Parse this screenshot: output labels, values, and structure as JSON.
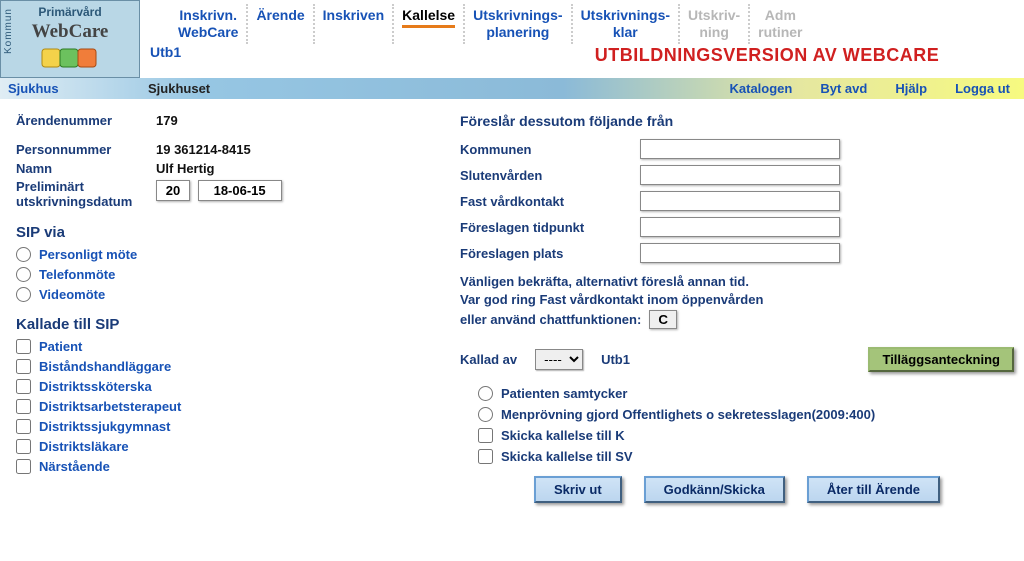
{
  "logo": {
    "top": "Primärvård",
    "name": "WebCare",
    "side": "Kommun"
  },
  "tabs": [
    {
      "l1": "Inskrivn.",
      "l2": "WebCare",
      "active": false,
      "disabled": false
    },
    {
      "l1": "Ärende",
      "l2": "",
      "active": false,
      "disabled": false
    },
    {
      "l1": "Inskriven",
      "l2": "",
      "active": false,
      "disabled": false
    },
    {
      "l1": "Kallelse",
      "l2": "",
      "active": true,
      "disabled": false
    },
    {
      "l1": "Utskrivnings-",
      "l2": "planering",
      "active": false,
      "disabled": false
    },
    {
      "l1": "Utskrivnings-",
      "l2": "klar",
      "active": false,
      "disabled": false
    },
    {
      "l1": "Utskriv-",
      "l2": "ning",
      "active": false,
      "disabled": true
    },
    {
      "l1": "Adm",
      "l2": "rutiner",
      "active": false,
      "disabled": true
    }
  ],
  "banner_left": "Utb1",
  "banner": "UTBILDNINGSVERSION AV WEBCARE",
  "subbar": {
    "col1_label": "Sjukhus",
    "col1_val": "Sjukhuset",
    "links": [
      "Katalogen",
      "Byt avd",
      "Hjälp",
      "Logga ut"
    ]
  },
  "left": {
    "arendenummer_label": "Ärendenummer",
    "arendenummer": "179",
    "personnummer_label": "Personnummer",
    "personnummer": "19 361214-8415",
    "namn_label": "Namn",
    "namn": "Ulf Hertig",
    "prelim_label1": "Preliminärt",
    "prelim_label2": "utskrivningsdatum",
    "date_y": "20",
    "date_rest": "18-06-15",
    "sip_heading": "SIP via",
    "sip_options": [
      "Personligt möte",
      "Telefonmöte",
      "Videomöte"
    ],
    "kallade_heading": "Kallade till SIP",
    "kallade_options": [
      "Patient",
      "Biståndshandläggare",
      "Distriktssköterska",
      "Distriktsarbetsterapeut",
      "Distriktssjukgymnast",
      "Distriktsläkare",
      "Närstående"
    ]
  },
  "right": {
    "heading": "Föreslår dessutom följande från",
    "fields": [
      {
        "label": "Kommunen",
        "name": "kommunen"
      },
      {
        "label": "Slutenvården",
        "name": "slutenvarden"
      },
      {
        "label": "Fast vårdkontakt",
        "name": "fast-vardkontakt"
      },
      {
        "label": "Föreslagen tidpunkt",
        "name": "foreslagen-tidpunkt"
      },
      {
        "label": "Föreslagen plats",
        "name": "foreslagen-plats"
      }
    ],
    "confirm_l1": "Vänligen bekräfta, alternativt föreslå annan tid.",
    "confirm_l2": "Var god ring Fast vårdkontakt inom öppenvården",
    "confirm_l3": "eller använd chattfunktionen:",
    "chat_btn": "C",
    "kallad_label": "Kallad av",
    "kallad_select_first": "----",
    "kallad_utb": "Utb1",
    "tillagg": "Tilläggsanteckning",
    "consent": [
      {
        "type": "radio",
        "label": "Patienten samtycker"
      },
      {
        "type": "radio",
        "label": "Menprövning gjord Offentlighets o sekretesslagen(2009:400)"
      },
      {
        "type": "checkbox",
        "label": "Skicka kallelse till K"
      },
      {
        "type": "checkbox",
        "label": "Skicka kallelse till SV"
      }
    ],
    "actions": [
      "Skriv ut",
      "Godkänn/Skicka",
      "Åter till Ärende"
    ]
  }
}
